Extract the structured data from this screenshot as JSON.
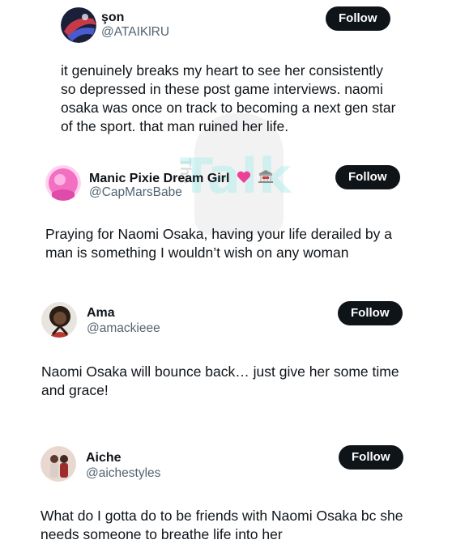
{
  "watermark": {
    "line1": "The",
    "line2": "Talk"
  },
  "posts": [
    {
      "name": "şon",
      "handle": "@ATAIKlRU",
      "follow_label": "Follow",
      "text": "it genuinely breaks my heart to see her consistently so depressed in these post game interviews. naomi osaka was once on track to becoming a next gen star of the sport. that man ruined her life.",
      "avatar_colors": [
        "#1a1f3a",
        "#c73a4a",
        "#4a5ad0"
      ]
    },
    {
      "name": "Manic Pixie Dream Girl",
      "handle": "@CapMarsBabe",
      "follow_label": "Follow",
      "text": "Praying for Naomi Osaka, having your life derailed by a man is something I wouldn’t wish on any woman",
      "emojis": [
        "pink-heart",
        "bank"
      ],
      "avatar_colors": [
        "#f26fc1",
        "#ffd1ef"
      ]
    },
    {
      "name": "Ama",
      "handle": "@amackieee",
      "follow_label": "Follow",
      "text": "Naomi Osaka will bounce back… just give her some time and grace!",
      "avatar_colors": [
        "#2a1d14",
        "#b8372f"
      ]
    },
    {
      "name": "Aiche",
      "handle": "@aichestyles",
      "follow_label": "Follow",
      "text": "What do I gotta do to be friends with Naomi Osaka bc she needs someone to breathe life into her",
      "avatar_colors": [
        "#e9d8cf",
        "#9b2d2d"
      ]
    }
  ]
}
